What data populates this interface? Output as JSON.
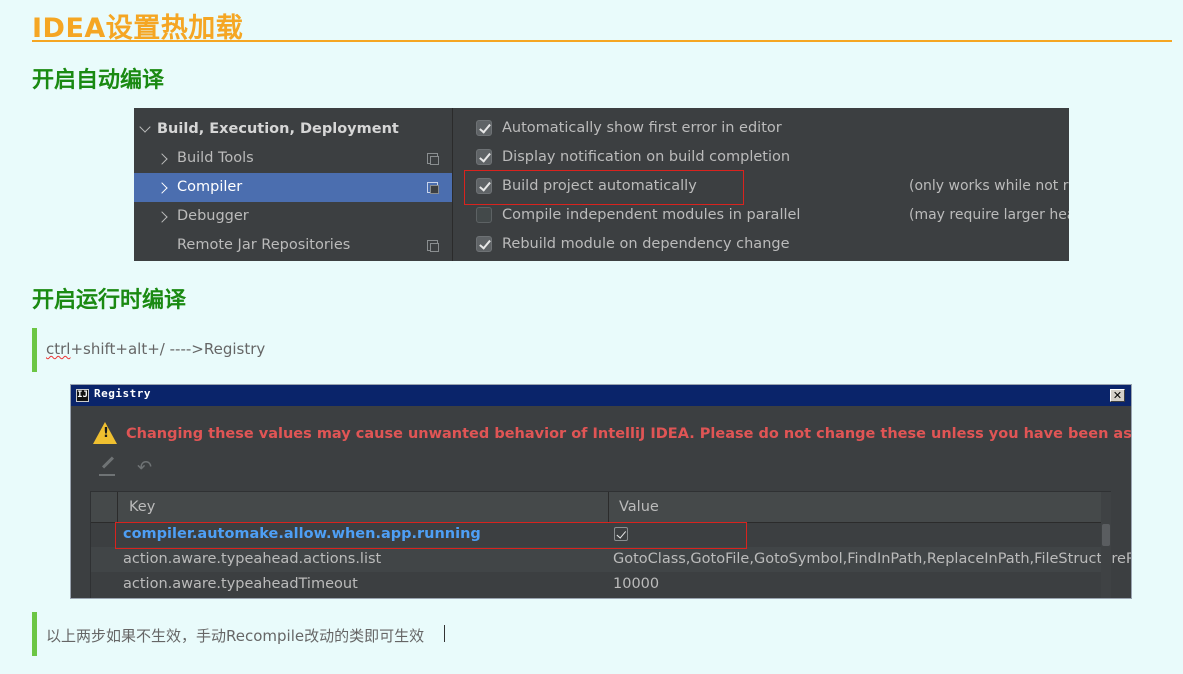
{
  "page": {
    "title": "IDEA设置热加载",
    "section1": "开启自动编译",
    "section2": "开启运行时编译",
    "quote1_underlined": "ctrl",
    "quote1_rest": "+shift+alt+/ ---->Registry",
    "quote2": "以上两步如果不生效，手动Recompile改动的类即可生效"
  },
  "settings": {
    "tree": [
      {
        "label": "Build, Execution, Deployment",
        "expanded": true
      },
      {
        "label": "Build Tools"
      },
      {
        "label": "Compiler",
        "selected": true
      },
      {
        "label": "Debugger"
      },
      {
        "label": "Remote Jar Repositories"
      }
    ],
    "options": [
      {
        "label": "Automatically show first error in editor",
        "checked": true
      },
      {
        "label": "Display notification on build completion",
        "checked": true
      },
      {
        "label": "Build project automatically",
        "checked": true,
        "note": "(only works while not ru"
      },
      {
        "label": "Compile independent modules in parallel",
        "checked": false,
        "note": "(may require larger heap"
      },
      {
        "label": "Rebuild module on dependency change",
        "checked": true
      }
    ],
    "highlight_color": "#d9231e"
  },
  "registry": {
    "window_title": "Registry",
    "warning": "Changing these values may cause unwanted behavior of IntelliJ IDEA. Please do not change these unless you have been asked.",
    "columns": [
      "Key",
      "Value"
    ],
    "rows": [
      {
        "key": "compiler.automake.allow.when.app.running",
        "value": "",
        "checked": true
      },
      {
        "key": "action.aware.typeahead.actions.list",
        "value": "GotoClass,GotoFile,GotoSymbol,FindInPath,ReplaceInPath,FileStructurePo"
      },
      {
        "key": "action.aware.typeaheadTimeout",
        "value": "10000"
      }
    ]
  },
  "icons": [
    "warning-icon",
    "edit-icon",
    "undo-icon",
    "close-icon",
    "intellij-icon",
    "copy-icon",
    "chevron-right-icon",
    "chevron-down-icon",
    "checkbox-icon"
  ],
  "colors": {
    "title": "#f5a623",
    "section": "#1a8a12",
    "quote_bar": "#6cc644",
    "selection": "#4b6eaf",
    "warning_text": "#e05555",
    "key_highlight": "#4e9ff5"
  }
}
